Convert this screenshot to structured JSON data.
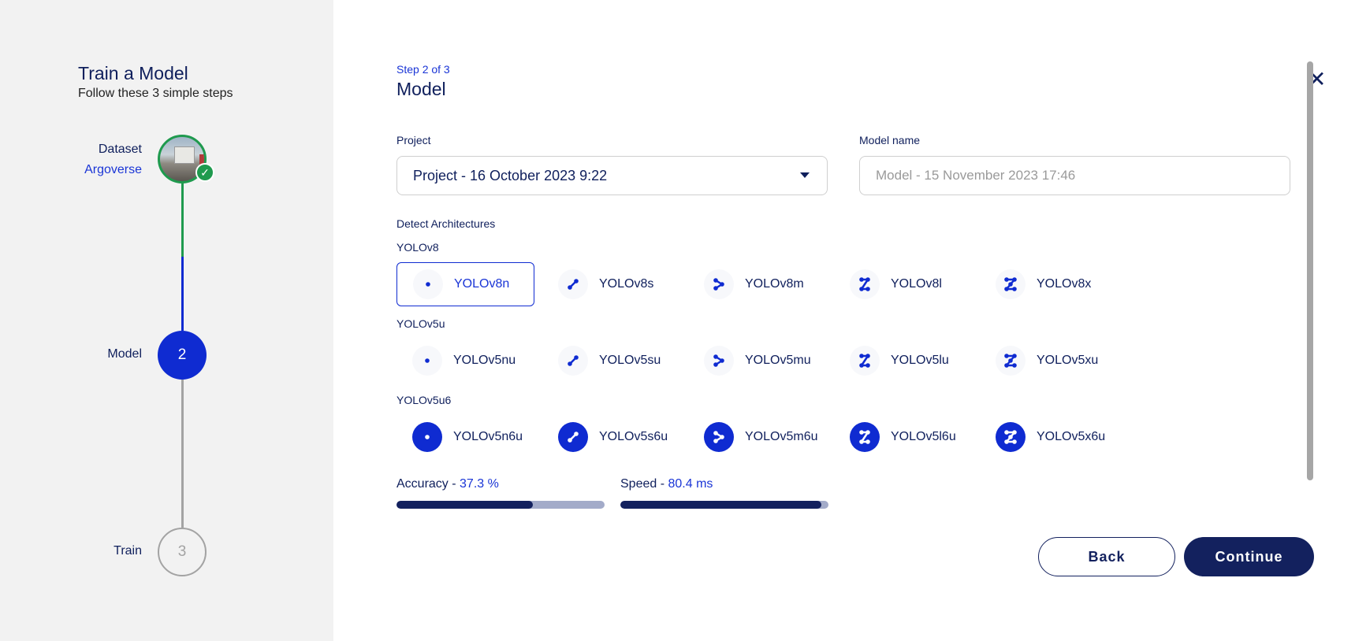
{
  "sidebar": {
    "title": "Train a Model",
    "subtitle": "Follow these 3 simple steps",
    "steps": [
      {
        "label": "Dataset",
        "sub": "Argoverse",
        "status": "completed"
      },
      {
        "label": "Model",
        "number": "2",
        "status": "active"
      },
      {
        "label": "Train",
        "number": "3",
        "status": "pending"
      }
    ]
  },
  "main": {
    "step_count": "Step 2 of 3",
    "title": "Model",
    "project_label": "Project",
    "project_value": "Project - 16 October 2023 9:22",
    "model_name_label": "Model name",
    "model_name_placeholder": "Model - 15 November 2023 17:46",
    "architectures_label": "Detect Architectures",
    "groups": [
      {
        "name": "YOLOv8",
        "items": [
          "YOLOv8n",
          "YOLOv8s",
          "YOLOv8m",
          "YOLOv8l",
          "YOLOv8x"
        ],
        "selected": "YOLOv8n"
      },
      {
        "name": "YOLOv5u",
        "items": [
          "YOLOv5nu",
          "YOLOv5su",
          "YOLOv5mu",
          "YOLOv5lu",
          "YOLOv5xu"
        ]
      },
      {
        "name": "YOLOv5u6",
        "items": [
          "YOLOv5n6u",
          "YOLOv5s6u",
          "YOLOv5m6u",
          "YOLOv5l6u",
          "YOLOv5x6u"
        ]
      }
    ],
    "accuracy_label": "Accuracy - ",
    "accuracy_value": "37.3 %",
    "accuracy_fraction": 0.655,
    "speed_label": "Speed - ",
    "speed_value": "80.4 ms",
    "speed_fraction": 0.965,
    "back_label": "Back",
    "continue_label": "Continue"
  },
  "colors": {
    "accent": "#0f2bd1",
    "navy": "#13215e",
    "success": "#1f9a4e"
  }
}
